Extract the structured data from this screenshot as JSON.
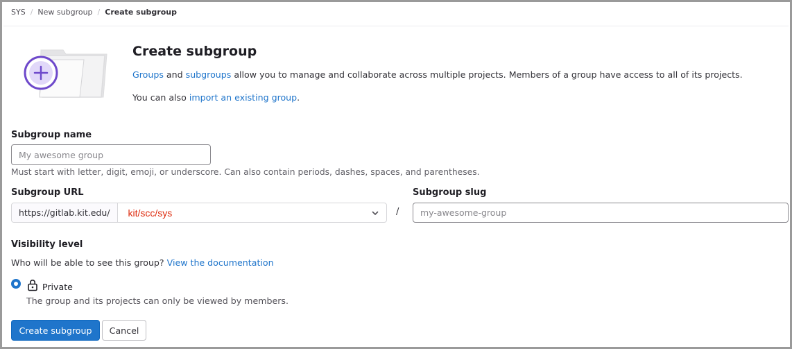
{
  "breadcrumb": {
    "items": [
      "SYS",
      "New subgroup",
      "Create subgroup"
    ],
    "separator": "/"
  },
  "header": {
    "title": "Create subgroup",
    "desc_link_groups": "Groups",
    "desc_and": "and",
    "desc_link_subgroups": "subgroups",
    "desc_rest": "allow you to manage and collaborate across multiple projects. Members of a group have access to all of its projects.",
    "import_prefix": "You can also",
    "import_link": "import an existing group",
    "import_suffix": "."
  },
  "form": {
    "name_label": "Subgroup name",
    "name_placeholder": "My awesome group",
    "name_value": "",
    "name_help": "Must start with letter, digit, emoji, or underscore. Can also contain periods, dashes, spaces, and parentheses.",
    "url_label": "Subgroup URL",
    "url_prefix": "https://gitlab.kit.edu/",
    "url_namespace": "kit/scc/sys",
    "url_separator": "/",
    "slug_label": "Subgroup slug",
    "slug_placeholder": "my-awesome-group",
    "slug_value": ""
  },
  "visibility": {
    "label": "Visibility level",
    "question": "Who will be able to see this group?",
    "doc_link": "View the documentation",
    "options": [
      {
        "label": "Private",
        "help": "The group and its projects can only be viewed by members.",
        "icon": "lock-icon",
        "selected": true
      }
    ]
  },
  "actions": {
    "submit_label": "Create subgroup",
    "cancel_label": "Cancel"
  },
  "colors": {
    "primary": "#1f75cb",
    "link": "#1f75cb",
    "namespace_text": "#dd2b0e",
    "illustration_accent": "#6e49cb"
  }
}
